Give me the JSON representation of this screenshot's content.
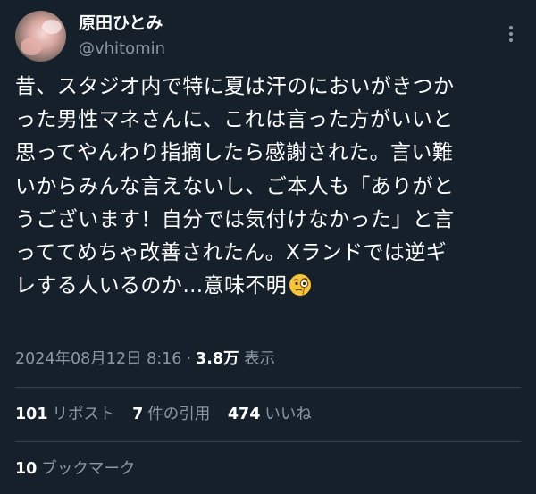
{
  "author": {
    "display_name": "原田ひとみ",
    "handle": "@vhitomin"
  },
  "more_icon": "more-vertical-icon",
  "tweet": {
    "lines": [
      "昔、スタジオ内で特に夏は汗のにおいがきつか",
      "った男性マネさんに、これは言った方がいいと",
      "思ってやんわり指摘したら感謝された。言い難",
      "いからみんな言えないし、ご本人も「ありがと",
      "うございます！自分では気付けなかった」と言",
      "っててめちゃ改善されたん。Xランドでは逆ギ",
      "レする人いるのか…意味不明"
    ],
    "emoji": "face-with-monocle-emoji"
  },
  "meta": {
    "timestamp": "2024年08月12日 8:16",
    "separator": "·",
    "views_count": "3.8万",
    "views_label": "表示"
  },
  "stats": {
    "reposts_count": "101",
    "reposts_label": "リポスト",
    "quotes_count": "7",
    "quotes_label": "件の引用",
    "likes_count": "474",
    "likes_label": "いいね"
  },
  "bookmarks": {
    "count": "10",
    "label": "ブックマーク"
  },
  "colors": {
    "background": "#15202b",
    "text_primary": "#ffffff",
    "text_secondary": "#8b98a5",
    "divider": "#38444d"
  }
}
